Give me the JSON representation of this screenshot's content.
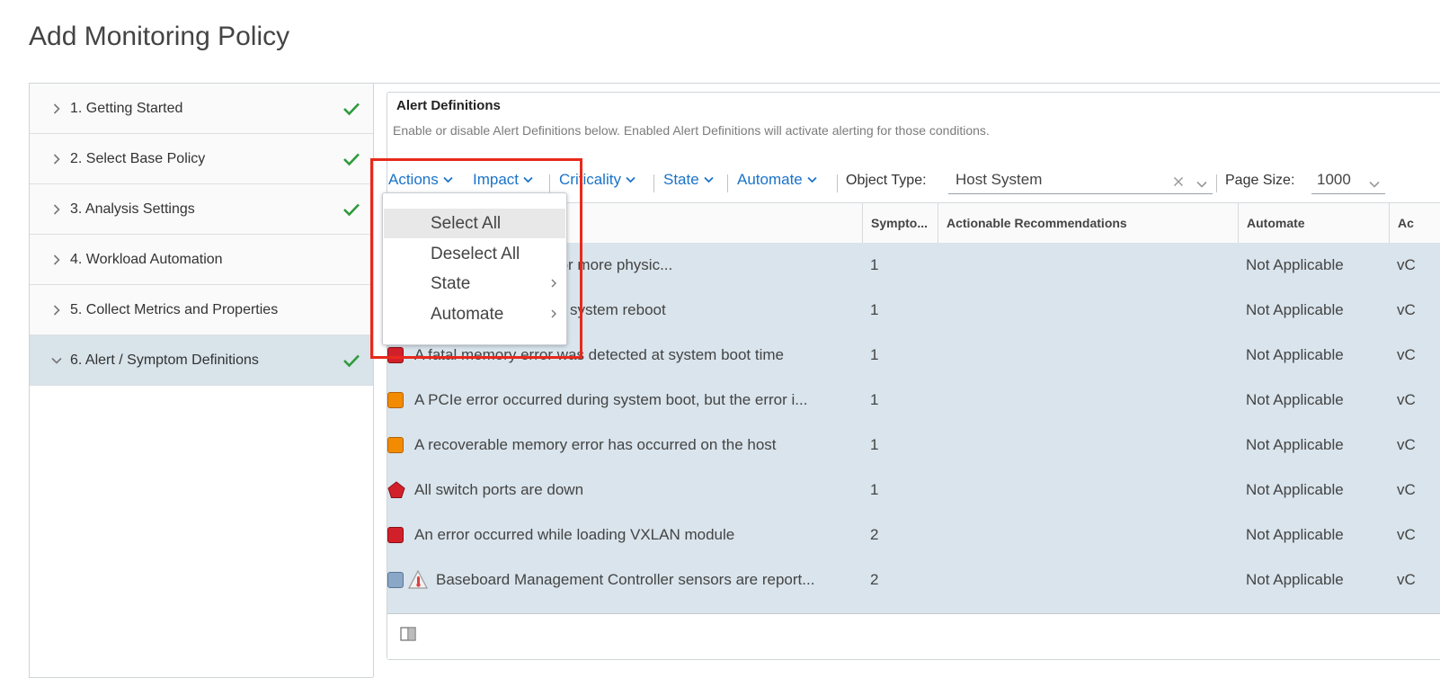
{
  "page": {
    "title": "Add Monitoring Policy"
  },
  "wizard": {
    "steps": [
      {
        "label": "1. Getting Started",
        "completed": true,
        "expanded": false
      },
      {
        "label": "2. Select Base Policy",
        "completed": true,
        "expanded": false
      },
      {
        "label": "3. Analysis Settings",
        "completed": true,
        "expanded": false
      },
      {
        "label": "4. Workload Automation",
        "completed": false,
        "expanded": false
      },
      {
        "label": "5. Collect Metrics and Properties",
        "completed": false,
        "expanded": false
      },
      {
        "label": "6. Alert / Symptom Definitions",
        "completed": true,
        "expanded": true
      }
    ]
  },
  "panel": {
    "title": "Alert Definitions",
    "description": "Enable or disable Alert Definitions below. Enabled Alert Definitions will activate alerting for those conditions."
  },
  "toolbar": {
    "actions": "Actions",
    "impact": "Impact",
    "criticality": "Criticality",
    "state": "State",
    "automate": "Automate",
    "object_type_label": "Object Type:",
    "object_type_value": "Host System",
    "page_size_label": "Page Size:",
    "page_size_value": "1000"
  },
  "actions_menu": {
    "items": [
      "Select All",
      "Deselect All",
      "State",
      "Automate"
    ]
  },
  "table": {
    "columns": [
      "Sympto...",
      "Actionable Recommendations",
      "Automate",
      "Ac"
    ],
    "rows": [
      {
        "icon": "none",
        "name": "ss was found for one or more physic...",
        "symptoms": "1",
        "recommendations": "",
        "automate": "Not Applicable",
        "adapter": "vC"
      },
      {
        "icon": "none",
        "name": "l on a PCIe bus during system reboot",
        "symptoms": "1",
        "recommendations": "",
        "automate": "Not Applicable",
        "adapter": "vC"
      },
      {
        "icon": "critical-square",
        "name": "A fatal memory error was detected at system boot time",
        "symptoms": "1",
        "recommendations": "",
        "automate": "Not Applicable",
        "adapter": "vC"
      },
      {
        "icon": "warning-square",
        "name": "A PCIe error occurred during system boot, but the error i...",
        "symptoms": "1",
        "recommendations": "",
        "automate": "Not Applicable",
        "adapter": "vC"
      },
      {
        "icon": "warning-square",
        "name": "A recoverable memory error has occurred on the host",
        "symptoms": "1",
        "recommendations": "",
        "automate": "Not Applicable",
        "adapter": "vC"
      },
      {
        "icon": "critical-pentagon",
        "name": "All switch ports are down",
        "symptoms": "1",
        "recommendations": "",
        "automate": "Not Applicable",
        "adapter": "vC"
      },
      {
        "icon": "critical-square",
        "name": "An error occurred while loading VXLAN module",
        "symptoms": "2",
        "recommendations": "",
        "automate": "Not Applicable",
        "adapter": "vC"
      },
      {
        "icon": "info-square-thermo",
        "name": "Baseboard Management Controller sensors are report...",
        "symptoms": "2",
        "recommendations": "",
        "automate": "Not Applicable",
        "adapter": "vC"
      }
    ]
  },
  "colors": {
    "link": "#1a73c9",
    "critical": "#d2202a",
    "warning": "#f38b00",
    "info": "#8aa7c8",
    "success": "#2e9b3c",
    "highlight": "#e8291c",
    "row_selected": "#d9e4ec"
  }
}
